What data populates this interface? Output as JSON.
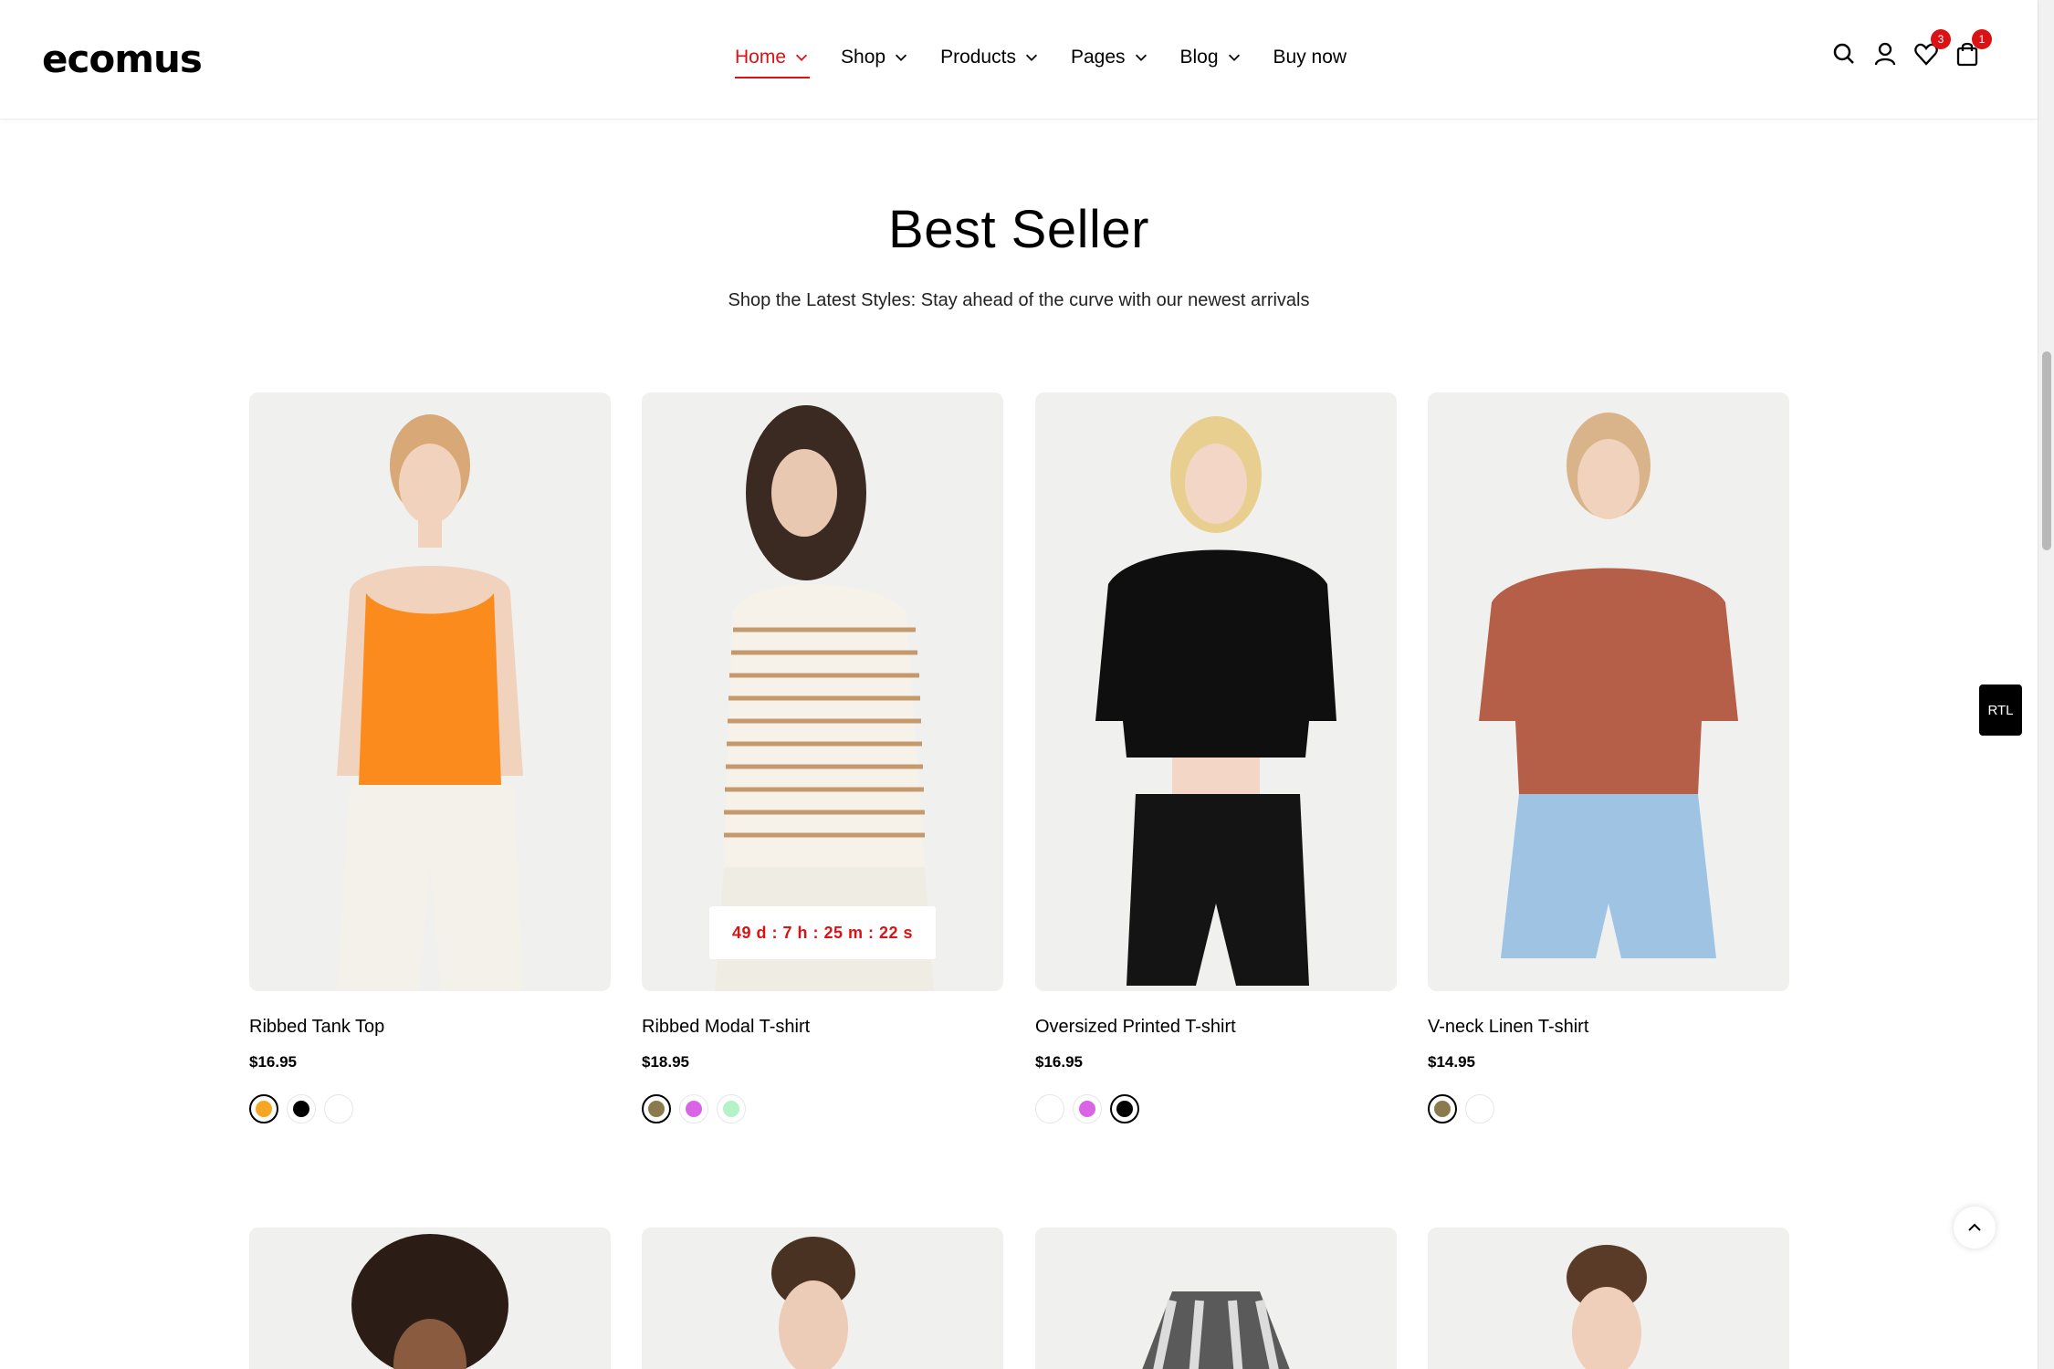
{
  "brand": {
    "logo_text": "ecomus"
  },
  "nav": {
    "items": [
      {
        "label": "Home",
        "active": true
      },
      {
        "label": "Shop"
      },
      {
        "label": "Products"
      },
      {
        "label": "Pages"
      },
      {
        "label": "Blog"
      },
      {
        "label": "Buy now"
      }
    ]
  },
  "header_icons": {
    "search": "search-icon",
    "account": "user-icon",
    "wishlist": {
      "icon": "heart-icon",
      "count": "3"
    },
    "cart": {
      "icon": "cart-icon",
      "count": "1"
    }
  },
  "section": {
    "title": "Best Seller",
    "subtitle": "Shop the Latest Styles: Stay ahead of the curve with our newest arrivals"
  },
  "products": [
    {
      "name": "Ribbed Tank Top",
      "price": "$16.95",
      "swatches": [
        "#f5a623",
        "#000000",
        "#ffffff"
      ],
      "active_swatch": 0
    },
    {
      "name": "Ribbed Modal T-shirt",
      "price": "$18.95",
      "swatches": [
        "#8c7a4f",
        "#d964e6",
        "#b5f2c8"
      ],
      "active_swatch": 0,
      "countdown": "49 d : 7 h : 25 m : 22 s"
    },
    {
      "name": "Oversized Printed T-shirt",
      "price": "$16.95",
      "swatches": [
        "#ffffff",
        "#d964e6",
        "#000000"
      ],
      "active_swatch": 2
    },
    {
      "name": "V-neck Linen T-shirt",
      "price": "$14.95",
      "swatches": [
        "#8c7a4f",
        "#ffffff"
      ],
      "active_swatch": 0
    }
  ],
  "floating": {
    "rtl_label": "RTL",
    "back_to_top": "chevron-up-icon"
  },
  "colors": {
    "accent": "#db1215",
    "badge": "#db1215",
    "card_bg": "#f2f2f2"
  }
}
